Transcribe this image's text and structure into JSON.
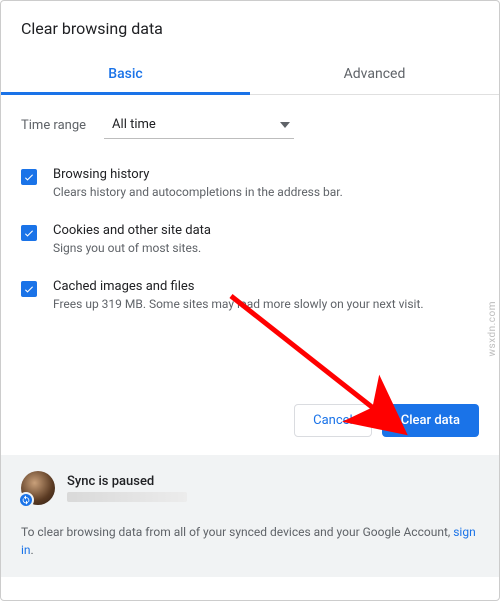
{
  "dialog": {
    "title": "Clear browsing data"
  },
  "tabs": {
    "basic": "Basic",
    "advanced": "Advanced"
  },
  "timeRange": {
    "label": "Time range",
    "value": "All time"
  },
  "options": {
    "history": {
      "title": "Browsing history",
      "desc": "Clears history and autocompletions in the address bar."
    },
    "cookies": {
      "title": "Cookies and other site data",
      "desc": "Signs you out of most sites."
    },
    "cache": {
      "title": "Cached images and files",
      "desc": "Frees up 319 MB. Some sites may load more slowly on your next visit."
    }
  },
  "buttons": {
    "cancel": "Cancel",
    "clear": "Clear data"
  },
  "sync": {
    "status": "Sync is paused"
  },
  "footer": {
    "note": "To clear browsing data from all of your synced devices and your Google Account, ",
    "link": "sign in",
    "period": "."
  },
  "watermark": "wsxdn.com"
}
